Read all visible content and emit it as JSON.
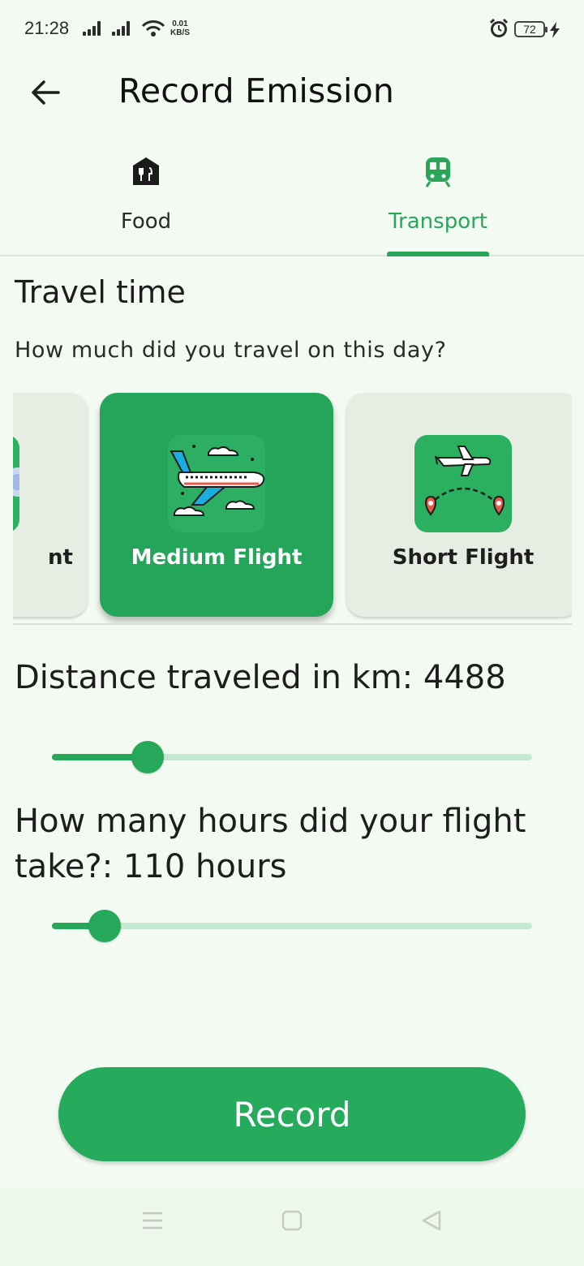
{
  "status_bar": {
    "time": "21:28",
    "net_speed_value": "0.01",
    "net_speed_unit": "KB/S",
    "battery": "72"
  },
  "app_bar": {
    "title": "Record Emission",
    "back_icon": "arrow-left-icon"
  },
  "tabs": [
    {
      "label": "Food",
      "icon": "restaurant-icon",
      "selected": false
    },
    {
      "label": "Transport",
      "icon": "train-icon",
      "selected": true
    }
  ],
  "colors": {
    "accent": "#26ab5d",
    "background": "#f3faf2",
    "card": "#e6eee4",
    "track": "#c4e9cf"
  },
  "travel": {
    "title": "Travel time",
    "question": "How much did you travel on this day?",
    "options": [
      {
        "label": "nt",
        "icon": "long-flight-icon",
        "selected": false
      },
      {
        "label": "Medium Flight",
        "icon": "medium-flight-icon",
        "selected": true
      },
      {
        "label": "Short Flight",
        "icon": "short-flight-icon",
        "selected": false
      }
    ]
  },
  "distance": {
    "label": "Distance traveled in km:  4488",
    "slider_fraction": 0.2
  },
  "hours": {
    "label": "How many hours did your flight take?: 110 hours",
    "slider_fraction": 0.11
  },
  "record_button": {
    "label": "Record"
  },
  "nav_bar": [
    "menu-icon",
    "home-square-icon",
    "back-triangle-icon"
  ]
}
